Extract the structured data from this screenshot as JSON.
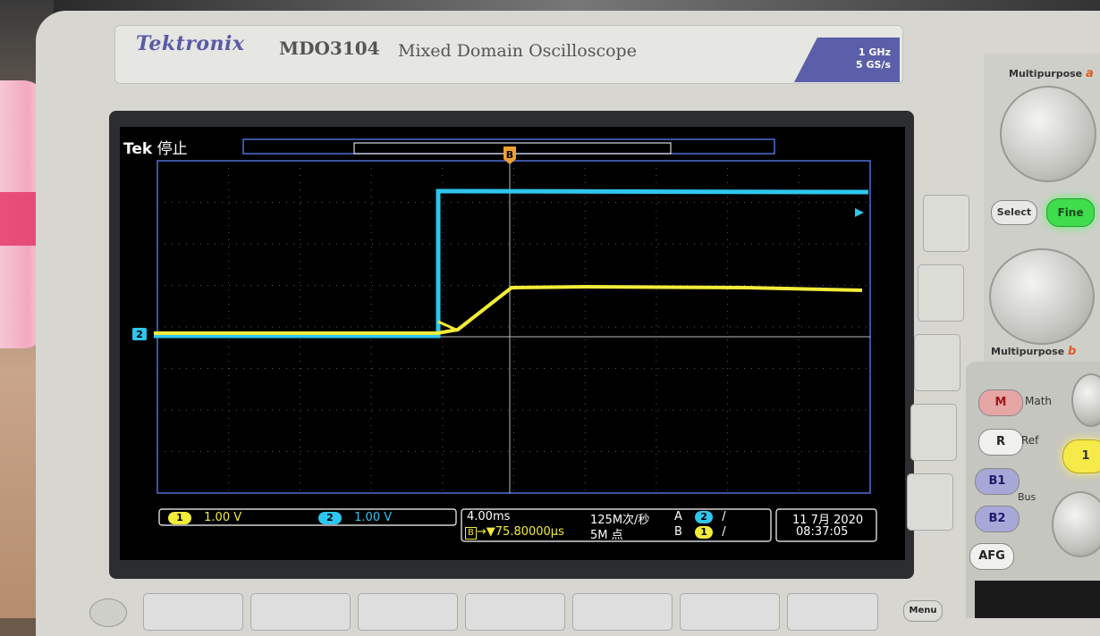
{
  "instrument": {
    "brand": "Tektronix",
    "model": "MDO3104",
    "description": "Mixed Domain Oscilloscope",
    "bandwidth": "1 GHz",
    "sample_rate": "5 GS/s"
  },
  "screen": {
    "status_brand": "Tek",
    "status_state": "停止",
    "trigger_marker": "B",
    "ch2_marker": "2",
    "colors": {
      "ch1": "#f2ec3a",
      "ch2": "#2ec6ee",
      "grid": "#4a4a4a",
      "frame": "#4e6fd6"
    }
  },
  "readouts": {
    "ch1_badge": "1",
    "ch1_scale": "1.00 V",
    "ch2_badge": "2",
    "ch2_scale": "1.00 V",
    "timebase": "4.00ms",
    "delay_badge": "B",
    "delay": "▼75.80000µs",
    "sample_rate": "125M次/秒",
    "record_length": "5M 点",
    "trig_a_label": "A",
    "trig_a_ch": "2",
    "trig_b_label": "B",
    "trig_b_ch": "1",
    "slope": "/",
    "date": "11 7月 2020",
    "time": "08:37:05"
  },
  "panel": {
    "multipurpose_a": "Multipurpose",
    "multipurpose_a_letter": "a",
    "multipurpose_b": "Multipurpose",
    "multipurpose_b_letter": "b",
    "select": "Select",
    "fine": "Fine",
    "math_btn": "M",
    "math_label": "Math",
    "ref_btn": "R",
    "ref_label": "Ref",
    "b1": "B1",
    "b2": "B2",
    "bus_label": "Bus",
    "afg": "AFG",
    "ch1_btn": "1",
    "menu": "Menu"
  }
}
